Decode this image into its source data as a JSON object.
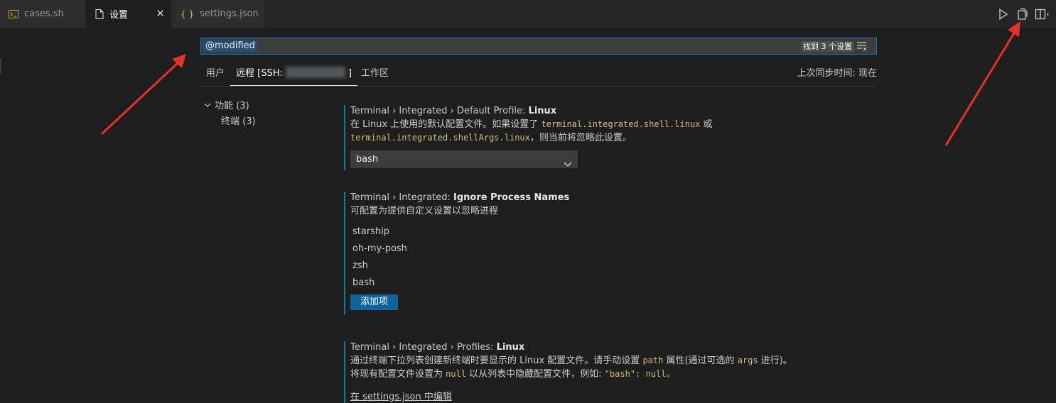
{
  "tabs": [
    {
      "label": "cases.sh",
      "icon": "terminal-file-icon"
    },
    {
      "label": "设置",
      "icon": "file-icon",
      "close": "✕"
    },
    {
      "label": "settings.json",
      "icon": "json-braces-icon",
      "icon_text": "{ }"
    }
  ],
  "search": {
    "query": "@modified",
    "count_badge": "找到 3 个设置"
  },
  "scopes": {
    "user": "用户",
    "remote_prefix": "远程 [SSH:",
    "remote_suffix": "]",
    "workspace": "工作区",
    "last_sync": "上次同步时间: 现在"
  },
  "toc": {
    "group_label": "功能",
    "group_count": "(3)",
    "child_label": "终端",
    "child_count": "(3)"
  },
  "settings": [
    {
      "category": "Terminal › Integrated › Default Profile:",
      "name": "Linux",
      "desc_part1": "在 Linux 上使用的默认配置文件。如果设置了 ",
      "desc_code1": "terminal.integrated.shell.linux",
      "desc_part2": " 或",
      "desc_code2": "terminal.integrated.shellArgs.linux",
      "desc_part3": "，则当前将忽略此设置。",
      "value": "bash"
    },
    {
      "category": "Terminal › Integrated:",
      "name": "Ignore Process Names",
      "desc": "可配置为提供自定义设置以忽略进程",
      "items": [
        "starship",
        "oh-my-posh",
        "zsh",
        "bash"
      ],
      "add_button": "添加项"
    },
    {
      "category": "Terminal › Integrated › Profiles:",
      "name": "Linux",
      "line1_a": "通过终端下拉列表创建新终端时要显示的 Linux 配置文件。请手动设置 ",
      "line1_code1": "path",
      "line1_b": " 属性(通过可选的 ",
      "line1_code2": "args",
      "line1_c": " 进行)。",
      "line2_a": "将现有配置文件设置为 ",
      "line2_code1": "null",
      "line2_b": " 以从列表中隐藏配置文件，例如: ",
      "line2_code2": "\"bash\": null",
      "line2_c": "。",
      "edit_link": "在 settings.json 中编辑"
    }
  ],
  "colors": {
    "accent": "#007fd4",
    "modified_bar": "#0c7d9d",
    "button": "#0e639c",
    "annotation_arrow": "#e8302a"
  }
}
